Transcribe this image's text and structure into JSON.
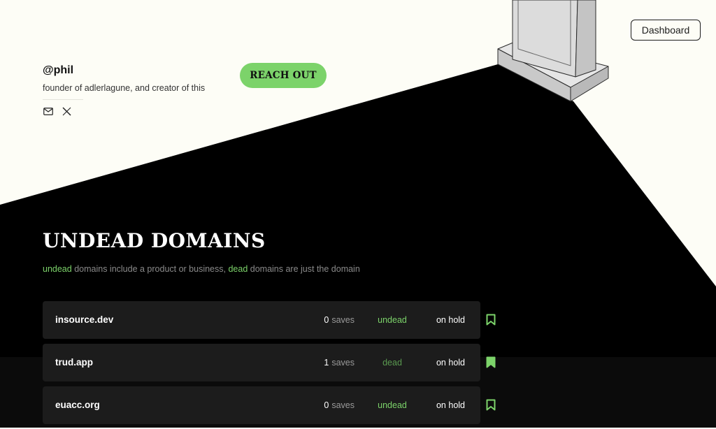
{
  "header": {
    "dashboard_label": "Dashboard"
  },
  "profile": {
    "handle": "@phil",
    "bio": "founder of adlerlagune, and creator of this",
    "reach_out_label": "REACH OUT",
    "social_icons": [
      "mail-icon",
      "x-icon"
    ]
  },
  "section": {
    "title": "UNDEAD DOMAINS",
    "subtitle": {
      "undead_word": "undead",
      "part1": " domains include a product or business, ",
      "dead_word": "dead",
      "part2": " domains are just the domain"
    }
  },
  "domains": [
    {
      "name": "insource.dev",
      "saves_count": "0",
      "saves_label": "saves",
      "status": "undead",
      "state": "on hold",
      "bookmarked": false
    },
    {
      "name": "trud.app",
      "saves_count": "1",
      "saves_label": "saves",
      "status": "dead",
      "state": "on hold",
      "bookmarked": true
    },
    {
      "name": "euacc.org",
      "saves_count": "0",
      "saves_label": "saves",
      "status": "undead",
      "state": "on hold",
      "bookmarked": false
    }
  ],
  "colors": {
    "accent": "#7cd36a",
    "background": "#fdfdf6",
    "shadow": "#000000",
    "row": "#1c1c1c"
  }
}
